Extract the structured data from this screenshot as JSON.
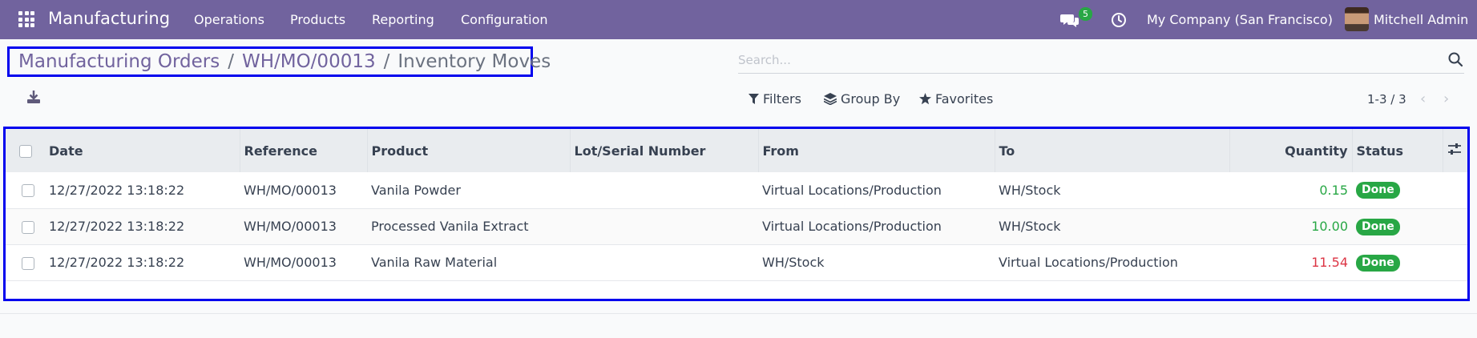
{
  "navbar": {
    "app_name": "Manufacturing",
    "menu": [
      "Operations",
      "Products",
      "Reporting",
      "Configuration"
    ],
    "message_count": "5",
    "company": "My Company (San Francisco)",
    "user": "Mitchell Admin",
    "bg_color": "#71639e"
  },
  "breadcrumb": {
    "items": [
      "Manufacturing Orders",
      "WH/MO/00013"
    ],
    "separator": "/",
    "current": "Inventory Moves"
  },
  "search": {
    "placeholder": "Search..."
  },
  "filters": {
    "filters_label": "Filters",
    "group_by_label": "Group By",
    "favorites_label": "Favorites"
  },
  "pager": {
    "value": "1-3 / 3",
    "prev": "‹",
    "next": "›"
  },
  "table": {
    "columns": [
      "Date",
      "Reference",
      "Product",
      "Lot/Serial Number",
      "From",
      "To",
      "Quantity",
      "Status"
    ],
    "rows": [
      {
        "date": "12/27/2022 13:18:22",
        "reference": "WH/MO/00013",
        "product": "Vanila Powder",
        "lot": "",
        "from": "Virtual Locations/Production",
        "to": "WH/Stock",
        "quantity": "0.15",
        "quantity_color": "#28a745",
        "status": "Done"
      },
      {
        "date": "12/27/2022 13:18:22",
        "reference": "WH/MO/00013",
        "product": "Processed Vanila Extract",
        "lot": "",
        "from": "Virtual Locations/Production",
        "to": "WH/Stock",
        "quantity": "10.00",
        "quantity_color": "#28a745",
        "status": "Done"
      },
      {
        "date": "12/27/2022 13:18:22",
        "reference": "WH/MO/00013",
        "product": "Vanila Raw Material",
        "lot": "",
        "from": "WH/Stock",
        "to": "Virtual Locations/Production",
        "quantity": "11.54",
        "quantity_color": "#dc3545",
        "status": "Done"
      }
    ]
  }
}
